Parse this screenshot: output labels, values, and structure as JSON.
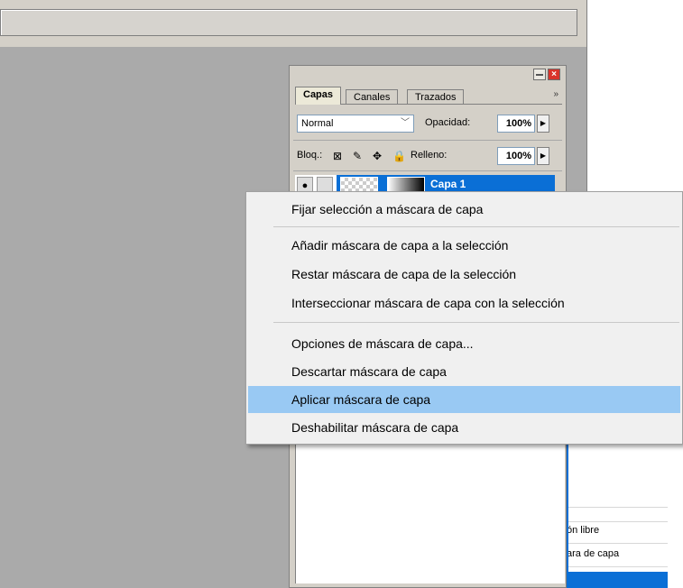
{
  "layers_panel": {
    "tabs": [
      "Capas",
      "Canales",
      "Trazados"
    ],
    "active_tab": "Capas",
    "blend_mode": "Normal",
    "opacity_label": "Opacidad:",
    "opacity_value": "100%",
    "lock_label": "Bloq.:",
    "fill_label": "Relleno:",
    "fill_value": "100%",
    "layer_name": "Capa 1"
  },
  "context_menu": {
    "items": [
      "Fijar selección a máscara de capa",
      "Añadir máscara de capa a la selección",
      "Restar máscara de capa de la selección",
      "Interseccionar máscara de capa con la selección",
      "Opciones de máscara de capa...",
      "Descartar máscara de capa",
      "Aplicar máscara de capa",
      "Deshabilitar máscara de capa"
    ],
    "highlighted": "Aplicar máscara de capa"
  },
  "history_panel": {
    "visible_items": [
      "ón libre",
      "ara de capa"
    ]
  },
  "colors": {
    "workspace": "#aaaaaa",
    "selection_blue": "#0a6fd6",
    "menu_highlight": "#99c9f3"
  }
}
